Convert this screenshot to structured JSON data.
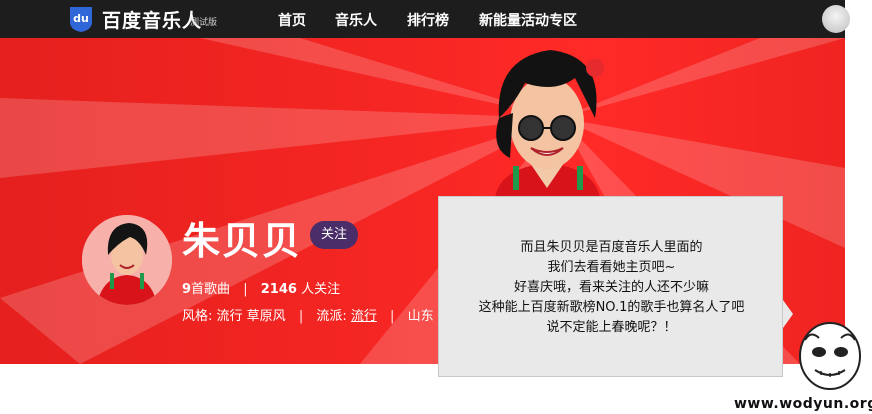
{
  "header": {
    "logo_text": "百度音乐人",
    "logo_badge": "测试版",
    "logo_icon": "du-logo-icon",
    "nav": [
      "首页",
      "音乐人",
      "排行榜",
      "新能量活动专区"
    ]
  },
  "colors": {
    "nav_bg": "#1d1d1d",
    "banner_red": "#f52623",
    "follow_btn": "#4a2d69",
    "caption_bg": "#e9e9e9"
  },
  "profile": {
    "name": "朱贝贝",
    "follow_label": "关注",
    "songs_count": "9",
    "songs_label": "首歌曲",
    "divider": "|",
    "fans_count": "2146",
    "fans_label": "人关注",
    "style_label": "风格:",
    "style_values": "流行 草原风",
    "genre_label": "流派:",
    "genre_value": "流行",
    "region_value": "山东"
  },
  "caption": {
    "lines": [
      "而且朱贝贝是百度音乐人里面的",
      "我们去看看她主页吧~",
      "好喜庆哦，看来关注的人还不少嘛",
      "这种能上百度新歌榜NO.1的歌手也算名人了吧",
      "说不定能上春晚呢？！"
    ]
  },
  "watermark": "www.wodyun.org"
}
